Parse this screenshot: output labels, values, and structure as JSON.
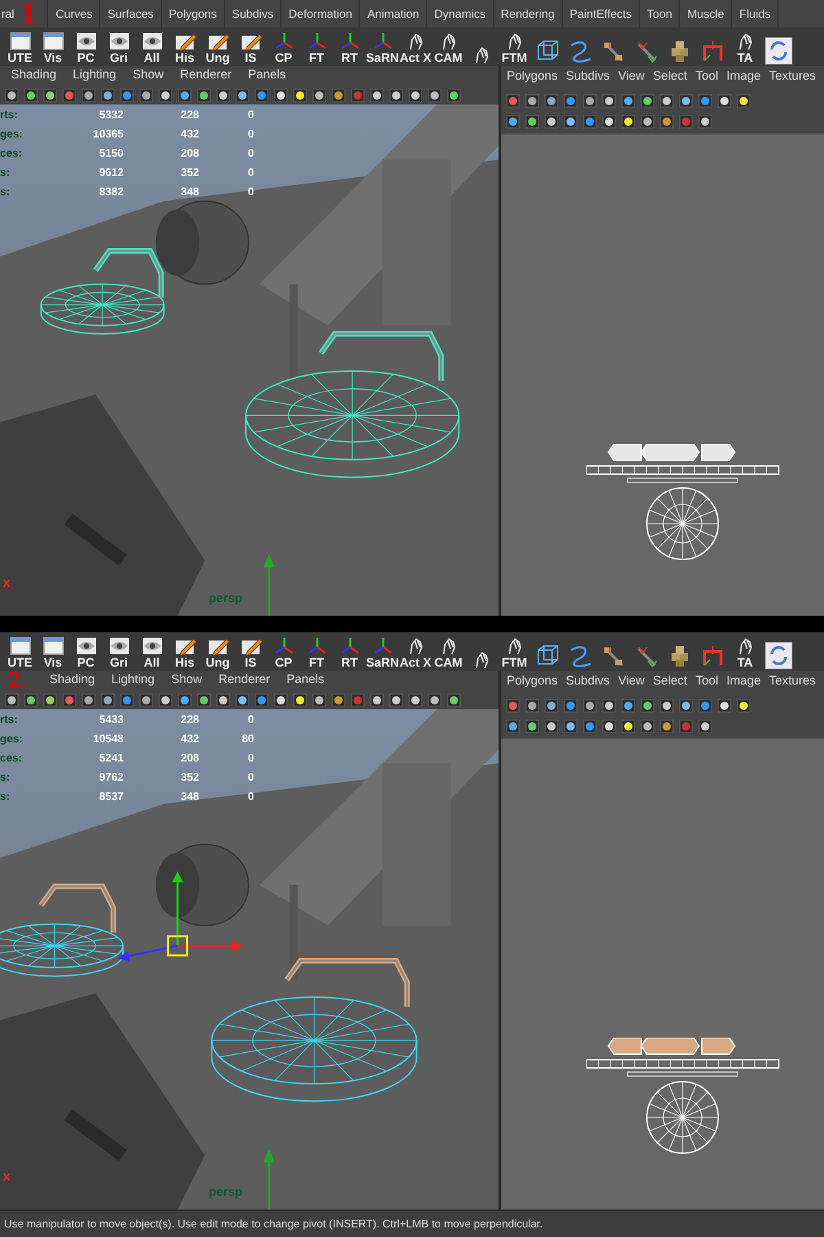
{
  "steps": [
    {
      "number": "1",
      "tabs": [
        "ral",
        "Curves",
        "Surfaces",
        "Polygons",
        "Subdivs",
        "Deformation",
        "Animation",
        "Dynamics",
        "Rendering",
        "PaintEffects",
        "Toon",
        "Muscle",
        "Fluids"
      ],
      "shelf": [
        {
          "kind": "window",
          "label": "UTE"
        },
        {
          "kind": "window",
          "label": "Vis"
        },
        {
          "kind": "eye",
          "label": "PC"
        },
        {
          "kind": "eye",
          "label": "Gri"
        },
        {
          "kind": "eye",
          "label": "All"
        },
        {
          "kind": "pencil",
          "label": "His"
        },
        {
          "kind": "pencil",
          "label": "Ung"
        },
        {
          "kind": "pencil",
          "label": "IS"
        },
        {
          "kind": "axes",
          "label": "CP"
        },
        {
          "kind": "axes",
          "label": "FT"
        },
        {
          "kind": "axes",
          "label": "RT"
        },
        {
          "kind": "axes",
          "label": "SaRN"
        },
        {
          "kind": "hand",
          "label": "Act X"
        },
        {
          "kind": "hand",
          "label": "CAM"
        },
        {
          "kind": "hand"
        },
        {
          "kind": "hand",
          "label": "FTM"
        },
        {
          "kind": "tool"
        },
        {
          "kind": "tool"
        },
        {
          "kind": "tool"
        },
        {
          "kind": "tool"
        },
        {
          "kind": "tool"
        },
        {
          "kind": "tool"
        },
        {
          "kind": "hand",
          "label": "TA"
        },
        {
          "kind": "refresh"
        }
      ],
      "viewport": {
        "menus": [
          "Shading",
          "Lighting",
          "Show",
          "Renderer",
          "Panels"
        ],
        "stats": [
          {
            "label": "rts:",
            "values": [
              "5332",
              "228",
              "0"
            ]
          },
          {
            "label": "ges:",
            "values": [
              "10365",
              "432",
              "0"
            ]
          },
          {
            "label": "ces:",
            "values": [
              "5150",
              "208",
              "0"
            ]
          },
          {
            "label": "s:",
            "values": [
              "9612",
              "352",
              "0"
            ]
          },
          {
            "label": "s:",
            "values": [
              "8382",
              "348",
              "0"
            ]
          }
        ],
        "camera": "persp",
        "axis_label": "x",
        "manipulator": false
      },
      "uv_editor": {
        "menus": [
          "Polygons",
          "Subdivs",
          "View",
          "Select",
          "Tool",
          "Image",
          "Textures"
        ]
      }
    },
    {
      "number": "2.",
      "shelf": [
        {
          "kind": "window",
          "label": "UTE"
        },
        {
          "kind": "window",
          "label": "Vis"
        },
        {
          "kind": "eye",
          "label": "PC"
        },
        {
          "kind": "eye",
          "label": "Gri"
        },
        {
          "kind": "eye",
          "label": "All"
        },
        {
          "kind": "pencil",
          "label": "His"
        },
        {
          "kind": "pencil",
          "label": "Ung"
        },
        {
          "kind": "pencil",
          "label": "IS"
        },
        {
          "kind": "axes",
          "label": "CP"
        },
        {
          "kind": "axes",
          "label": "FT"
        },
        {
          "kind": "axes",
          "label": "RT"
        },
        {
          "kind": "axes",
          "label": "SaRN"
        },
        {
          "kind": "hand",
          "label": "Act X"
        },
        {
          "kind": "hand",
          "label": "CAM"
        },
        {
          "kind": "hand"
        },
        {
          "kind": "hand",
          "label": "FTM"
        },
        {
          "kind": "tool"
        },
        {
          "kind": "tool"
        },
        {
          "kind": "tool"
        },
        {
          "kind": "tool"
        },
        {
          "kind": "tool"
        },
        {
          "kind": "tool"
        },
        {
          "kind": "hand",
          "label": "TA"
        },
        {
          "kind": "refresh"
        }
      ],
      "viewport": {
        "menus": [
          "Shading",
          "Lighting",
          "Show",
          "Renderer",
          "Panels"
        ],
        "stats": [
          {
            "label": "rts:",
            "values": [
              "5433",
              "228",
              "0"
            ]
          },
          {
            "label": "ges:",
            "values": [
              "10548",
              "432",
              "80"
            ]
          },
          {
            "label": "ces:",
            "values": [
              "5241",
              "208",
              "0"
            ]
          },
          {
            "label": "s:",
            "values": [
              "9762",
              "352",
              "0"
            ]
          },
          {
            "label": "s:",
            "values": [
              "8537",
              "348",
              "0"
            ]
          }
        ],
        "camera": "persp",
        "axis_label": "x",
        "manipulator": true
      },
      "uv_editor": {
        "menus": [
          "Polygons",
          "Subdivs",
          "View",
          "Select",
          "Tool",
          "Image",
          "Textures"
        ]
      }
    }
  ],
  "status_bar": "Use manipulator to move object(s). Use edit mode to change pivot (INSERT).  Ctrl+LMB to move perpendicular."
}
